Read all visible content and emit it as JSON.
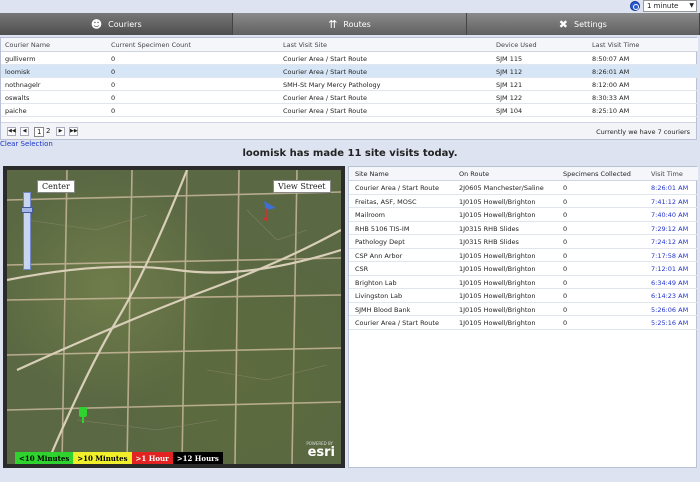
{
  "top": {
    "interval": "1 minute"
  },
  "tabs": [
    {
      "label": "Couriers",
      "icon": "courier-icon"
    },
    {
      "label": "Routes",
      "icon": "routes-icon"
    },
    {
      "label": "Settings",
      "icon": "settings-icon"
    }
  ],
  "couriers": {
    "headers": [
      "Courier Name",
      "Current Specimen Count",
      "Last Visit Site",
      "Device Used",
      "Last Visit Time"
    ],
    "rows": [
      [
        "gulliverm",
        "0",
        "Courier Area / Start Route",
        "SJM 115",
        "8:50:07 AM"
      ],
      [
        "loomisk",
        "0",
        "Courier Area / Start Route",
        "SJM 112",
        "8:26:01 AM"
      ],
      [
        "nothnagelr",
        "0",
        "SMH-St Mary Mercy Pathology",
        "SJM 121",
        "8:12:00 AM"
      ],
      [
        "oswalts",
        "0",
        "Courier Area / Start Route",
        "SJM 122",
        "8:30:33 AM"
      ],
      [
        "paiche",
        "0",
        "Courier Area / Start Route",
        "SJM 104",
        "8:25:10 AM"
      ]
    ],
    "pages": [
      "1",
      "2"
    ],
    "count_text": "Currently we have 7 couriers"
  },
  "clear_selection": "Clear Selection",
  "headline": "loomisk has made 11 site visits today.",
  "map": {
    "center_label": "Center",
    "view_street_label": "View Street",
    "legend": [
      "<10 Minutes",
      ">10 Minutes",
      ">1 Hour",
      ">12 Hours"
    ],
    "legend_colors": [
      "#2ed32e",
      "#f0ef2a",
      "#e32222",
      "#000000"
    ],
    "powered_by": "POWERED BY",
    "brand": "esri"
  },
  "visits": {
    "headers": [
      "Site Name",
      "On Route",
      "Specimens Collected",
      "Visit Time"
    ],
    "rows": [
      [
        "Courier Area / Start Route",
        "2J0605 Manchester/Saline",
        "0",
        "8:26:01 AM"
      ],
      [
        "Freitas, ASF, MOSC",
        "1J0105 Howell/Brighton",
        "0",
        "7:41:12 AM"
      ],
      [
        "Mailroom",
        "1J0105 Howell/Brighton",
        "0",
        "7:40:40 AM"
      ],
      [
        "RHB 5106 TIS-IM",
        "1J0315 RHB Slides",
        "0",
        "7:29:12 AM"
      ],
      [
        "Pathology Dept",
        "1J0315 RHB Slides",
        "0",
        "7:24:12 AM"
      ],
      [
        "CSP Ann Arbor",
        "1J0105 Howell/Brighton",
        "0",
        "7:17:58 AM"
      ],
      [
        "CSR",
        "1J0105 Howell/Brighton",
        "0",
        "7:12:01 AM"
      ],
      [
        "Brighton Lab",
        "1J0105 Howell/Brighton",
        "0",
        "6:34:49 AM"
      ],
      [
        "Livingston Lab",
        "1J0105 Howell/Brighton",
        "0",
        "6:14:23 AM"
      ],
      [
        "SJMH Blood Bank",
        "1J0105 Howell/Brighton",
        "0",
        "5:26:06 AM"
      ],
      [
        "Courier Area / Start Route",
        "1J0105 Howell/Brighton",
        "0",
        "5:25:16 AM"
      ]
    ]
  }
}
